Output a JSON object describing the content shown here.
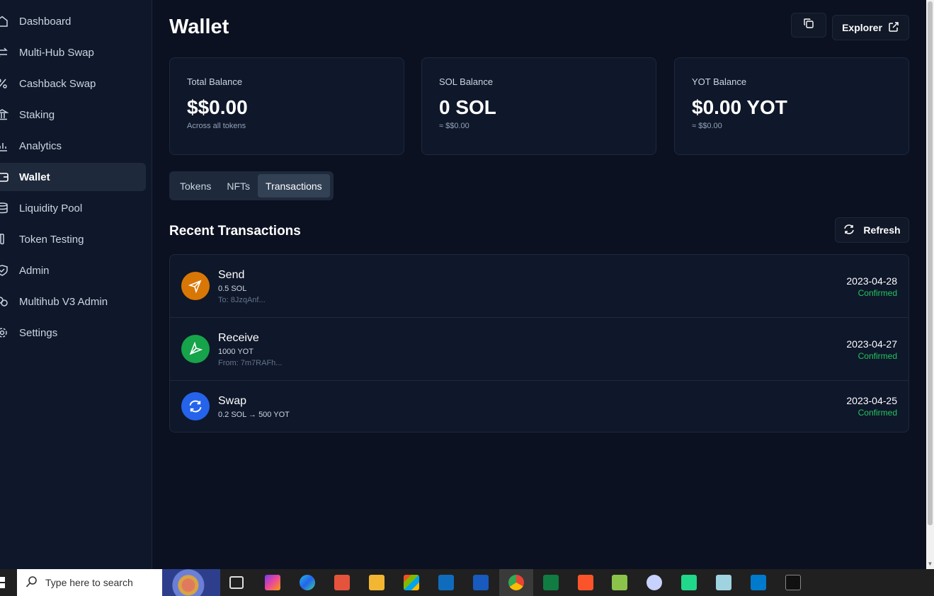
{
  "sidebar": {
    "items": [
      {
        "label": "Dashboard",
        "icon": "home-icon"
      },
      {
        "label": "Multi-Hub Swap",
        "icon": "swap-arrows-icon"
      },
      {
        "label": "Cashback Swap",
        "icon": "percent-icon"
      },
      {
        "label": "Staking",
        "icon": "bank-icon"
      },
      {
        "label": "Analytics",
        "icon": "bar-chart-icon"
      },
      {
        "label": "Wallet",
        "icon": "wallet-icon",
        "active": true
      },
      {
        "label": "Liquidity Pool",
        "icon": "database-icon"
      },
      {
        "label": "Token Testing",
        "icon": "test-tube-icon"
      },
      {
        "label": "Admin",
        "icon": "shield-icon"
      },
      {
        "label": "Multihub V3 Admin",
        "icon": "link-icon"
      },
      {
        "label": "Settings",
        "icon": "gear-icon"
      }
    ]
  },
  "header": {
    "title": "Wallet",
    "explorer_label": "Explorer"
  },
  "cards": [
    {
      "label": "Total Balance",
      "value": "$$0.00",
      "sub": "Across all tokens"
    },
    {
      "label": "SOL Balance",
      "value": "0 SOL",
      "sub": "≈ $$0.00"
    },
    {
      "label": "YOT Balance",
      "value": "$0.00 YOT",
      "sub": "≈ $$0.00"
    }
  ],
  "tabs": [
    {
      "label": "Tokens"
    },
    {
      "label": "NFTs"
    },
    {
      "label": "Transactions",
      "active": true
    }
  ],
  "transactions_section": {
    "title": "Recent Transactions",
    "refresh_label": "Refresh"
  },
  "transactions": [
    {
      "type": "Send",
      "amount": "0.5 SOL",
      "address": "To: 8JzqAnf...",
      "date": "2023-04-28",
      "status": "Confirmed",
      "icon": "send-icon",
      "color": "#d97706"
    },
    {
      "type": "Receive",
      "amount": "1000 YOT",
      "address": "From: 7m7RAFh...",
      "date": "2023-04-27",
      "status": "Confirmed",
      "icon": "receive-icon",
      "color": "#16a34a"
    },
    {
      "type": "Swap",
      "amount": "0.2 SOL → 500 YOT",
      "address": "",
      "date": "2023-04-25",
      "status": "Confirmed",
      "icon": "swap-icon",
      "color": "#2563eb"
    }
  ],
  "taskbar": {
    "search_placeholder": "Type here to search"
  },
  "colors": {
    "background": "#0b1120",
    "sidebar": "#0f172a",
    "border": "#1e293b",
    "success": "#22c55e"
  }
}
